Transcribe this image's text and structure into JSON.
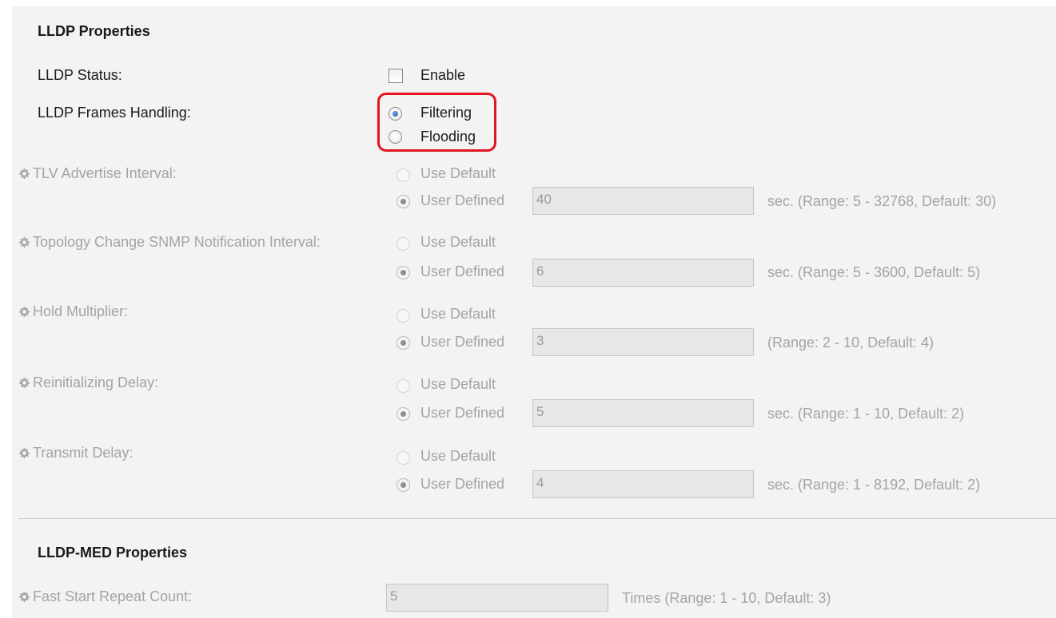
{
  "lldp_properties": {
    "title": "LLDP Properties",
    "status": {
      "label": "LLDP Status:",
      "enable_label": "Enable",
      "enable_checked": false
    },
    "frames_handling": {
      "label": "LLDP Frames Handling:",
      "options": [
        "Filtering",
        "Flooding"
      ],
      "selected": "Filtering"
    },
    "tlv_advertise_interval": {
      "label": "TLV Advertise Interval:",
      "use_default_label": "Use Default",
      "user_defined_label": "User Defined",
      "value": "40",
      "hint": "sec. (Range: 5 - 32768, Default: 30)"
    },
    "topology_change": {
      "label": "Topology Change SNMP Notification Interval:",
      "use_default_label": "Use Default",
      "user_defined_label": "User Defined",
      "value": "6",
      "hint": "sec. (Range: 5 - 3600, Default: 5)"
    },
    "hold_multiplier": {
      "label": "Hold Multiplier:",
      "use_default_label": "Use Default",
      "user_defined_label": "User Defined",
      "value": "3",
      "hint": "(Range: 2 - 10, Default: 4)"
    },
    "reinitializing_delay": {
      "label": "Reinitializing Delay:",
      "use_default_label": "Use Default",
      "user_defined_label": "User Defined",
      "value": "5",
      "hint": "sec. (Range: 1 - 10, Default: 2)"
    },
    "transmit_delay": {
      "label": "Transmit Delay:",
      "use_default_label": "Use Default",
      "user_defined_label": "User Defined",
      "value": "4",
      "hint": "sec. (Range: 1 - 8192, Default: 2)"
    }
  },
  "lldp_med_properties": {
    "title": "LLDP-MED Properties",
    "fast_start_repeat_count": {
      "label": "Fast Start Repeat Count:",
      "value": "5",
      "hint": "Times (Range: 1 - 10, Default: 3)"
    }
  },
  "colors": {
    "highlight": "#e3151f",
    "active_radio": "#1f4e9c",
    "disabled_text": "#a4a4a4"
  },
  "icons": {
    "setting": "gear-icon"
  }
}
